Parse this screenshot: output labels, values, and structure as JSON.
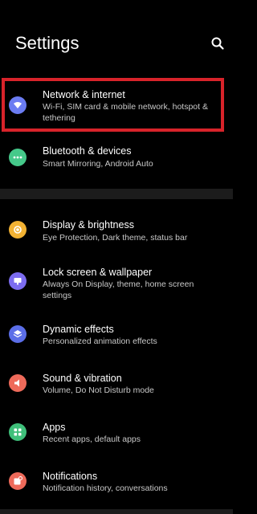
{
  "header": {
    "title": "Settings",
    "search_icon": "search-icon"
  },
  "colors": {
    "background": "#000000",
    "highlight": "#d8232a",
    "network": "#6b7cf2",
    "bluetooth": "#45c98a",
    "display": "#f2b233",
    "lock": "#7c6cf0",
    "dynamic": "#5b6ee8",
    "sound": "#ee6a5a",
    "apps": "#3fbf7a",
    "notifications": "#ee6a5a"
  },
  "items": [
    {
      "id": "network",
      "title": "Network & internet",
      "subtitle": "Wi-Fi, SIM card & mobile network, hotspot & tethering",
      "icon": "wifi-icon"
    },
    {
      "id": "bluetooth",
      "title": "Bluetooth & devices",
      "subtitle": "Smart Mirroring, Android Auto",
      "icon": "bluetooth-devices-icon"
    },
    {
      "id": "display",
      "title": "Display & brightness",
      "subtitle": "Eye Protection, Dark theme, status bar",
      "icon": "brightness-icon"
    },
    {
      "id": "lock",
      "title": "Lock screen & wallpaper",
      "subtitle": "Always On Display, theme, home screen settings",
      "icon": "wallpaper-icon"
    },
    {
      "id": "dynamic",
      "title": "Dynamic effects",
      "subtitle": "Personalized animation effects",
      "icon": "layers-icon"
    },
    {
      "id": "sound",
      "title": "Sound & vibration",
      "subtitle": "Volume, Do Not Disturb mode",
      "icon": "speaker-icon"
    },
    {
      "id": "apps",
      "title": "Apps",
      "subtitle": "Recent apps, default apps",
      "icon": "apps-grid-icon"
    },
    {
      "id": "notifications",
      "title": "Notifications",
      "subtitle": "Notification history, conversations",
      "icon": "notification-icon"
    }
  ]
}
